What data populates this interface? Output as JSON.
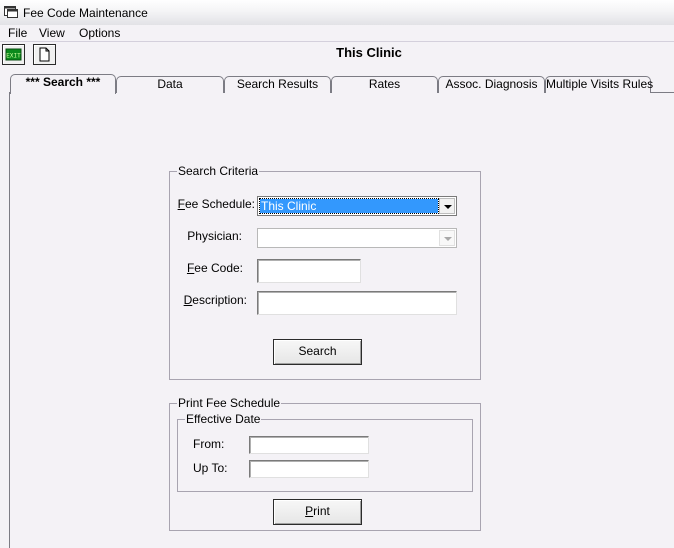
{
  "window": {
    "title": "Fee Code Maintenance",
    "icon": "app-window-icon"
  },
  "menu": {
    "items": [
      "File",
      "View",
      "Options"
    ]
  },
  "toolbar": {
    "exit_icon": "exit-icon",
    "new_icon": "new-document-icon",
    "clinic_title": "This Clinic"
  },
  "tabs": [
    "*** Search ***",
    "Data",
    "Search Results",
    "Rates",
    "Assoc. Diagnosis",
    "Multiple Visits Rules"
  ],
  "search_criteria": {
    "legend": "Search Criteria",
    "fee_schedule_label": "Fee Schedule:",
    "fee_schedule_value": "This Clinic",
    "physician_label": "Physician:",
    "physician_value": "",
    "fee_code_label": "Fee Code:",
    "fee_code_value": "",
    "description_label": "Description:",
    "description_value": "",
    "search_button": "Search"
  },
  "print_fee_schedule": {
    "legend": "Print Fee Schedule",
    "effective_date_legend": "Effective Date",
    "from_label": "From:",
    "from_value": "",
    "up_to_label": "Up To:",
    "up_to_value": "",
    "print_button": "Print"
  }
}
